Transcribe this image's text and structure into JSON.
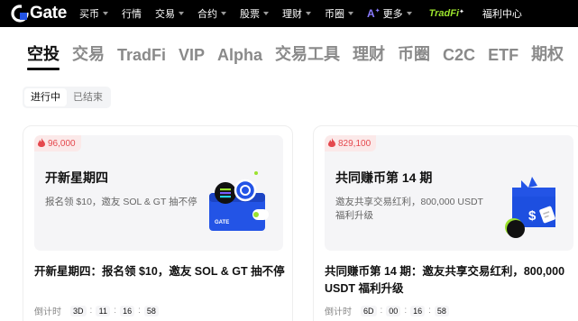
{
  "nav": {
    "logo_text": "Gate",
    "items": [
      {
        "label": "买币",
        "caret": true
      },
      {
        "label": "行情",
        "caret": false
      },
      {
        "label": "交易",
        "caret": true
      },
      {
        "label": "合约",
        "caret": true
      },
      {
        "label": "股票",
        "caret": true
      },
      {
        "label": "理财",
        "caret": true
      },
      {
        "label": "币圈",
        "caret": true
      }
    ],
    "ai_label": "A",
    "more_label": "更多",
    "tradfi_label": "TradFi",
    "welfare_label": "福利中心"
  },
  "categories": [
    "空投",
    "交易",
    "TradFi",
    "VIP",
    "Alpha",
    "交易工具",
    "理财",
    "币圈",
    "C2C",
    "ETF",
    "期权"
  ],
  "active_category": "空投",
  "status_tabs": {
    "ongoing": "进行中",
    "ended": "已结束"
  },
  "cards": [
    {
      "pool": "96,000",
      "banner_title": "开新星期四",
      "banner_desc": "报名领 $10，邀友 SOL & GT 抽不停",
      "art_label": "GATE",
      "title": "开新星期四：报名领 $10，邀友 SOL & GT 抽不停",
      "countdown_label": "倒计时",
      "countdown": [
        "3D",
        "11",
        "16",
        "58"
      ]
    },
    {
      "pool": "829,100",
      "banner_title": "共同赚币第 14 期",
      "banner_desc": "邀友共享交易红利，800,000 USDT 福利升级",
      "title": "共同赚币第 14 期：邀友共享交易红利，800,000 USDT 福利升级",
      "countdown_label": "倒计时",
      "countdown": [
        "6D",
        "00",
        "16",
        "58"
      ]
    }
  ],
  "colors": {
    "accent_red": "#e5484d",
    "brand_blue": "#2354e6",
    "tradfi_green": "#9be22d"
  }
}
